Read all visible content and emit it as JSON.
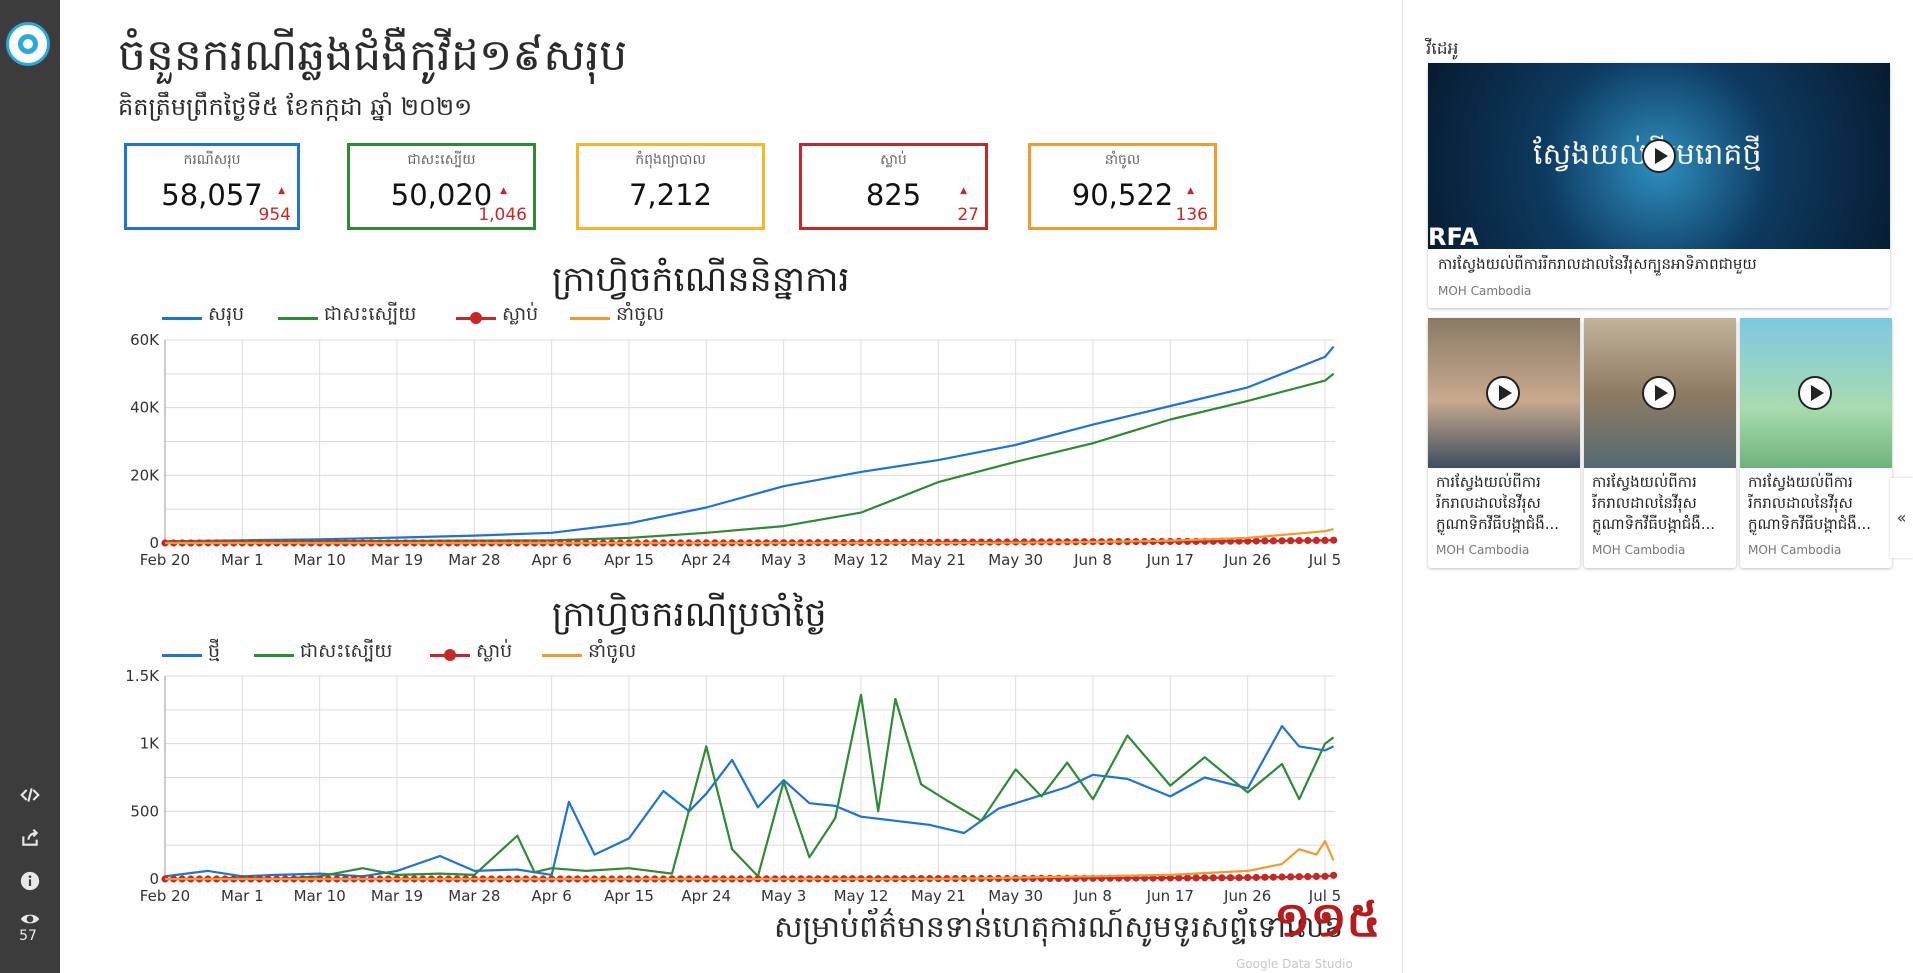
{
  "sidebar": {
    "view_count": "57"
  },
  "header": {
    "title": "ចំនួនករណីឆ្លងជំងឺកូវីដ១៩សរុប",
    "subtitle": "គិតត្រឹមព្រឹកថ្ងៃទី៥ ខែកក្កដា ឆ្នាំ ២០២១"
  },
  "stats": [
    {
      "label": "ករណីសរុប",
      "value": "58,057",
      "delta": "954",
      "color": "#1e73d8"
    },
    {
      "label": "ជាសះស្បើយ",
      "value": "50,020",
      "delta": "1,046",
      "color": "#2e8b35"
    },
    {
      "label": "កំពុងព្យាបាល",
      "value": "7,212",
      "delta": "",
      "color": "#f7b52c"
    },
    {
      "label": "ស្លាប់",
      "value": "825",
      "delta": "27",
      "color": "#c62828"
    },
    {
      "label": "នាំចូល",
      "value": "90,522",
      "delta": "136",
      "color": "#f39a2f"
    }
  ],
  "cumulative": {
    "title": "ក្រាហ្វិចកំណើននិន្នាការ",
    "legend": [
      "សរុប",
      "ជាសះស្បើយ",
      "ស្លាប់",
      "នាំចូល"
    ]
  },
  "daily": {
    "title": "ក្រាហ្វិចករណីប្រចាំថ្ងៃ",
    "legend": [
      "ថ្មី",
      "ជាសះស្បើយ",
      "ស្លាប់",
      "នាំចូល"
    ]
  },
  "chart_data": [
    {
      "type": "line",
      "title": "ក្រាហ្វិចកំណើននិន្នាការ",
      "x_tick_labels": [
        "Feb 20",
        "Mar 1",
        "Mar 10",
        "Mar 19",
        "Mar 28",
        "Apr 6",
        "Apr 15",
        "Apr 24",
        "May 3",
        "May 12",
        "May 21",
        "May 30",
        "Jun 8",
        "Jun 17",
        "Jun 26",
        "Jul 5"
      ],
      "x_start": "Feb 20",
      "x_end": "Jul 5",
      "y_ticks": [
        "0",
        "20K",
        "40K",
        "60K"
      ],
      "ylim": [
        0,
        60000
      ],
      "grid": true,
      "legend_position": "top-left",
      "series": [
        {
          "name": "សរុប",
          "color": "#1e73d8",
          "x": [
            "Feb 20",
            "Mar 1",
            "Mar 10",
            "Mar 19",
            "Mar 28",
            "Apr 6",
            "Apr 15",
            "Apr 24",
            "May 3",
            "May 12",
            "May 21",
            "May 30",
            "Jun 8",
            "Jun 17",
            "Jun 26",
            "Jul 5",
            "Jul 6"
          ],
          "y": [
            480,
            800,
            1100,
            1600,
            2200,
            3000,
            5800,
            10500,
            16800,
            21000,
            24500,
            29000,
            35000,
            40500,
            46000,
            55000,
            58057
          ]
        },
        {
          "name": "ជាសះស្បើយ",
          "color": "#2e8b35",
          "x": [
            "Feb 20",
            "Mar 1",
            "Mar 10",
            "Mar 19",
            "Mar 28",
            "Apr 6",
            "Apr 15",
            "Apr 24",
            "May 3",
            "May 12",
            "May 21",
            "May 30",
            "Jun 8",
            "Jun 17",
            "Jun 26",
            "Jul 5",
            "Jul 6"
          ],
          "y": [
            470,
            500,
            550,
            600,
            700,
            800,
            1500,
            3000,
            5000,
            9000,
            18000,
            24000,
            29500,
            36500,
            42000,
            48000,
            50020
          ]
        },
        {
          "name": "ស្លាប់",
          "color": "#c62828",
          "x": [
            "Feb 20",
            "Mar 1",
            "Mar 10",
            "Mar 19",
            "Mar 28",
            "Apr 6",
            "Apr 15",
            "Apr 24",
            "May 3",
            "May 12",
            "May 21",
            "May 30",
            "Jun 8",
            "Jun 17",
            "Jun 26",
            "Jul 5",
            "Jul 6"
          ],
          "y": [
            0,
            0,
            0,
            0,
            0,
            0,
            10,
            30,
            80,
            150,
            220,
            300,
            380,
            450,
            560,
            780,
            825
          ]
        },
        {
          "name": "នាំចូល",
          "color": "#f39a2f",
          "x": [
            "Feb 20",
            "Mar 1",
            "Mar 10",
            "Mar 19",
            "Mar 28",
            "Apr 6",
            "Apr 15",
            "Apr 24",
            "May 3",
            "May 12",
            "May 21",
            "May 30",
            "Jun 8",
            "Jun 17",
            "Jun 26",
            "Jul 5",
            "Jul 6"
          ],
          "y": [
            0,
            0,
            0,
            0,
            0,
            0,
            0,
            0,
            0,
            0,
            0,
            100,
            300,
            700,
            1500,
            3500,
            4100
          ]
        }
      ]
    },
    {
      "type": "line",
      "title": "ក្រាហ្វិចករណីប្រចាំថ្ងៃ",
      "x_tick_labels": [
        "Feb 20",
        "Mar 1",
        "Mar 10",
        "Mar 19",
        "Mar 28",
        "Apr 6",
        "Apr 15",
        "Apr 24",
        "May 3",
        "May 12",
        "May 21",
        "May 30",
        "Jun 8",
        "Jun 17",
        "Jun 26",
        "Jul 5"
      ],
      "x_start": "Feb 20",
      "x_end": "Jul 5",
      "y_ticks": [
        "0",
        "500",
        "1K",
        "1.5K"
      ],
      "ylim": [
        0,
        1500
      ],
      "grid": true,
      "legend_position": "top-left",
      "series": [
        {
          "name": "ថ្មី",
          "color": "#1e73d8",
          "x": [
            "Feb 20",
            "Feb 25",
            "Mar 1",
            "Mar 5",
            "Mar 10",
            "Mar 15",
            "Mar 19",
            "Mar 24",
            "Mar 28",
            "Apr 2",
            "Apr 6",
            "Apr 8",
            "Apr 11",
            "Apr 15",
            "Apr 19",
            "Apr 22",
            "Apr 24",
            "Apr 27",
            "Apr 30",
            "May 3",
            "May 6",
            "May 9",
            "May 12",
            "May 16",
            "May 20",
            "May 24",
            "May 28",
            "Jun 1",
            "Jun 5",
            "Jun 8",
            "Jun 12",
            "Jun 17",
            "Jun 21",
            "Jun 26",
            "Jun 30",
            "Jul 2",
            "Jul 5",
            "Jul 6"
          ],
          "y": [
            20,
            60,
            20,
            30,
            40,
            20,
            60,
            170,
            60,
            70,
            30,
            570,
            180,
            300,
            650,
            500,
            630,
            880,
            530,
            730,
            560,
            540,
            460,
            430,
            400,
            340,
            520,
            600,
            680,
            770,
            740,
            610,
            750,
            670,
            1130,
            980,
            950,
            980
          ]
        },
        {
          "name": "ជាសះស្បើយ",
          "color": "#2e8b35",
          "x": [
            "Feb 20",
            "Feb 25",
            "Mar 1",
            "Mar 5",
            "Mar 10",
            "Mar 15",
            "Mar 19",
            "Mar 24",
            "Mar 28",
            "Apr 2",
            "Apr 4",
            "Apr 6",
            "Apr 10",
            "Apr 15",
            "Apr 20",
            "Apr 24",
            "Apr 27",
            "Apr 30",
            "May 3",
            "May 6",
            "May 9",
            "May 12",
            "May 14",
            "May 16",
            "May 19",
            "May 22",
            "May 26",
            "May 30",
            "Jun 2",
            "Jun 5",
            "Jun 8",
            "Jun 12",
            "Jun 17",
            "Jun 21",
            "Jun 26",
            "Jun 30",
            "Jul 2",
            "Jul 5",
            "Jul 6"
          ],
          "y": [
            0,
            0,
            10,
            0,
            20,
            80,
            30,
            40,
            30,
            320,
            50,
            80,
            60,
            80,
            40,
            980,
            220,
            20,
            720,
            160,
            450,
            1360,
            500,
            1330,
            700,
            580,
            430,
            810,
            610,
            860,
            590,
            1060,
            690,
            900,
            640,
            850,
            590,
            1000,
            1046
          ]
        },
        {
          "name": "ស្លាប់",
          "color": "#c62828",
          "x": [
            "Feb 20",
            "Apr 15",
            "May 12",
            "Jun 8",
            "Jun 26",
            "Jul 5",
            "Jul 6"
          ],
          "y": [
            0,
            0,
            2,
            5,
            10,
            20,
            27
          ]
        },
        {
          "name": "នាំចូល",
          "color": "#f39a2f",
          "x": [
            "Feb 20",
            "May 21",
            "Jun 8",
            "Jun 17",
            "Jun 26",
            "Jun 30",
            "Jul 2",
            "Jul 4",
            "Jul 5",
            "Jul 6"
          ],
          "y": [
            0,
            0,
            20,
            30,
            60,
            110,
            220,
            180,
            280,
            136
          ]
        }
      ]
    }
  ],
  "footer": {
    "text": "សម្រាប់ព័ត៌មានទាន់ហេតុការណ៍សូមទូរសព្ទ័ទៅលេខ",
    "number": "១១៥",
    "watermark": "Google Data Studio"
  },
  "videos": {
    "section_title": "វីដេអូ",
    "featured": {
      "thumb_text": "ស្វែងយល់ពីមេរោគថ្មី",
      "thumb_logo": "RFA",
      "title": "ការស្វែងយល់ពីការរីករាលដាលនៃវីរុសក្បួនអាទិភាពជាមួយ",
      "channel": "MOH Cambodia"
    },
    "items": [
      {
        "title": "ការស្វែងយល់ពីការរីករាលដាលនៃវីរុសក្លូណាទិកវីធីបង្កាជំងឺ...",
        "channel": "MOH Cambodia"
      },
      {
        "title": "ការស្វែងយល់ពីការរីករាលដាលនៃវីរុសក្លូណាទិកវីធីបង្កាជំងឺ...",
        "channel": "MOH Cambodia"
      },
      {
        "title": "ការស្វែងយល់ពីការរីករាលដាលនៃវីរុសក្លូណាទិកវីធីបង្កាជំងឺ...",
        "channel": "MOH Cambodia"
      }
    ],
    "collapse_label": "«"
  }
}
